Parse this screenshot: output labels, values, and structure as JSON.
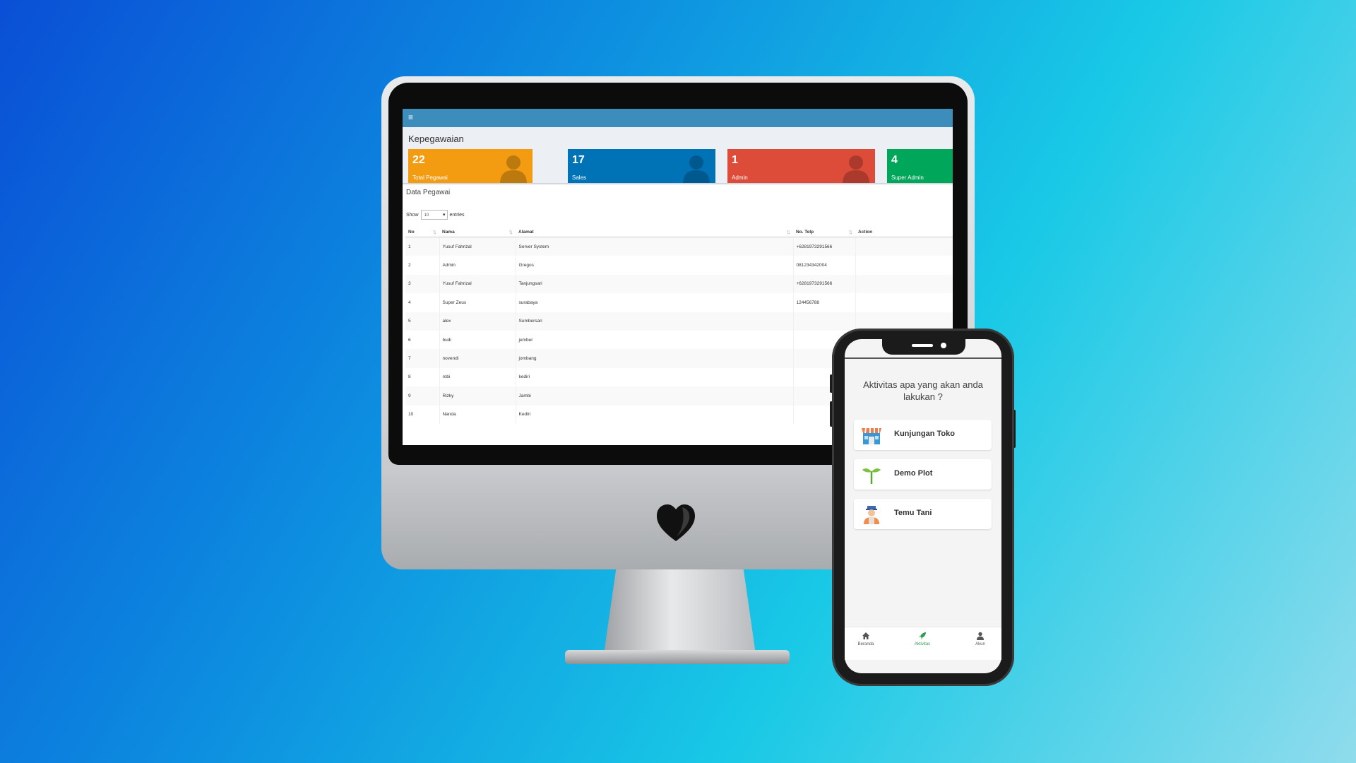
{
  "desktop": {
    "menu_icon": "hamburger-icon",
    "page_title": "Kepegawaian",
    "cards": [
      {
        "value": "22",
        "label": "Total Pegawai",
        "color": "#f39c12",
        "icon": "user-icon"
      },
      {
        "value": "17",
        "label": "Sales",
        "color": "#0073b7",
        "icon": "user-icon"
      },
      {
        "value": "1",
        "label": "Admin",
        "color": "#dd4b39",
        "icon": "user-icon"
      },
      {
        "value": "4",
        "label": "Super Admin",
        "color": "#00a65a",
        "icon": "user-icon"
      }
    ],
    "panel_title": "Data Pegawai",
    "show_label": "Show",
    "page_size": "10",
    "entries_label": "entries",
    "columns": [
      "No",
      "Nama",
      "Alamat",
      "No. Telp",
      "Action"
    ],
    "rows": [
      {
        "no": "1",
        "nama": "Yusuf Fahrizal",
        "alamat": "Server System",
        "telp": "+6281973291566"
      },
      {
        "no": "2",
        "nama": "Admin",
        "alamat": "Gregos",
        "telp": "081234342004"
      },
      {
        "no": "3",
        "nama": "Yusuf Fahrizal",
        "alamat": "Tanjungsari",
        "telp": "+6281973291566"
      },
      {
        "no": "4",
        "nama": "Super Zeus",
        "alamat": "surabaya",
        "telp": "124456788"
      },
      {
        "no": "5",
        "nama": "alex",
        "alamat": "Sumbersari",
        "telp": ""
      },
      {
        "no": "6",
        "nama": "budi",
        "alamat": "jember",
        "telp": ""
      },
      {
        "no": "7",
        "nama": "novendi",
        "alamat": "jombang",
        "telp": ""
      },
      {
        "no": "8",
        "nama": "robi",
        "alamat": "kediri",
        "telp": ""
      },
      {
        "no": "9",
        "nama": "Rizky",
        "alamat": "Jambi",
        "telp": ""
      },
      {
        "no": "10",
        "nama": "Nanda",
        "alamat": "Kediri",
        "telp": ""
      }
    ]
  },
  "mobile": {
    "question": "Aktivitas apa yang akan anda lakukan ?",
    "options": [
      {
        "label": "Kunjungan Toko",
        "icon": "store-icon"
      },
      {
        "label": "Demo Plot",
        "icon": "sprout-icon"
      },
      {
        "label": "Temu Tani",
        "icon": "farmer-icon"
      }
    ],
    "nav": [
      {
        "label": "Beranda",
        "icon": "home-icon"
      },
      {
        "label": "Aktivitas",
        "icon": "rocket-icon",
        "active": true
      },
      {
        "label": "Akun",
        "icon": "user-icon"
      }
    ],
    "accent": "#2e9e4f"
  }
}
